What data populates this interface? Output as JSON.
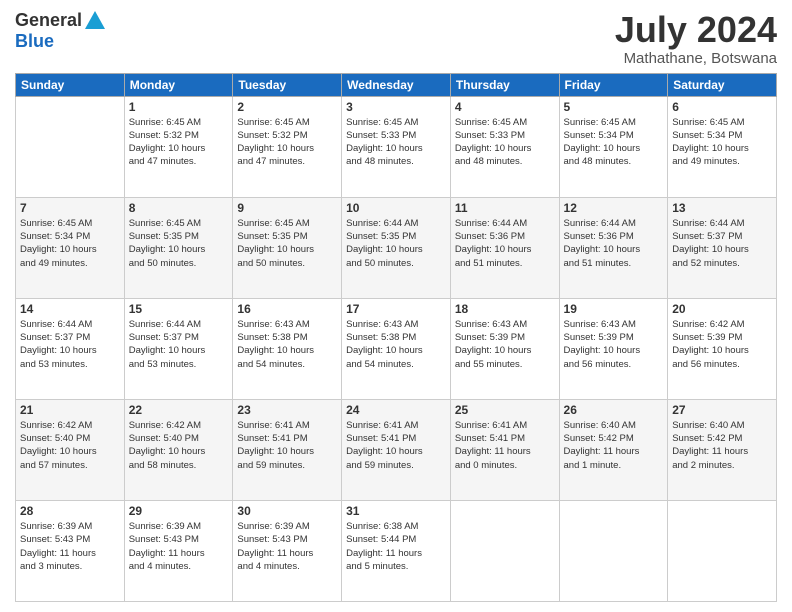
{
  "logo": {
    "general": "General",
    "blue": "Blue"
  },
  "title": {
    "month_year": "July 2024",
    "location": "Mathathane, Botswana"
  },
  "days_of_week": [
    "Sunday",
    "Monday",
    "Tuesday",
    "Wednesday",
    "Thursday",
    "Friday",
    "Saturday"
  ],
  "weeks": [
    [
      {
        "day": "",
        "info": ""
      },
      {
        "day": "1",
        "info": "Sunrise: 6:45 AM\nSunset: 5:32 PM\nDaylight: 10 hours\nand 47 minutes."
      },
      {
        "day": "2",
        "info": "Sunrise: 6:45 AM\nSunset: 5:32 PM\nDaylight: 10 hours\nand 47 minutes."
      },
      {
        "day": "3",
        "info": "Sunrise: 6:45 AM\nSunset: 5:33 PM\nDaylight: 10 hours\nand 48 minutes."
      },
      {
        "day": "4",
        "info": "Sunrise: 6:45 AM\nSunset: 5:33 PM\nDaylight: 10 hours\nand 48 minutes."
      },
      {
        "day": "5",
        "info": "Sunrise: 6:45 AM\nSunset: 5:34 PM\nDaylight: 10 hours\nand 48 minutes."
      },
      {
        "day": "6",
        "info": "Sunrise: 6:45 AM\nSunset: 5:34 PM\nDaylight: 10 hours\nand 49 minutes."
      }
    ],
    [
      {
        "day": "7",
        "info": "Sunrise: 6:45 AM\nSunset: 5:34 PM\nDaylight: 10 hours\nand 49 minutes."
      },
      {
        "day": "8",
        "info": "Sunrise: 6:45 AM\nSunset: 5:35 PM\nDaylight: 10 hours\nand 50 minutes."
      },
      {
        "day": "9",
        "info": "Sunrise: 6:45 AM\nSunset: 5:35 PM\nDaylight: 10 hours\nand 50 minutes."
      },
      {
        "day": "10",
        "info": "Sunrise: 6:44 AM\nSunset: 5:35 PM\nDaylight: 10 hours\nand 50 minutes."
      },
      {
        "day": "11",
        "info": "Sunrise: 6:44 AM\nSunset: 5:36 PM\nDaylight: 10 hours\nand 51 minutes."
      },
      {
        "day": "12",
        "info": "Sunrise: 6:44 AM\nSunset: 5:36 PM\nDaylight: 10 hours\nand 51 minutes."
      },
      {
        "day": "13",
        "info": "Sunrise: 6:44 AM\nSunset: 5:37 PM\nDaylight: 10 hours\nand 52 minutes."
      }
    ],
    [
      {
        "day": "14",
        "info": "Sunrise: 6:44 AM\nSunset: 5:37 PM\nDaylight: 10 hours\nand 53 minutes."
      },
      {
        "day": "15",
        "info": "Sunrise: 6:44 AM\nSunset: 5:37 PM\nDaylight: 10 hours\nand 53 minutes."
      },
      {
        "day": "16",
        "info": "Sunrise: 6:43 AM\nSunset: 5:38 PM\nDaylight: 10 hours\nand 54 minutes."
      },
      {
        "day": "17",
        "info": "Sunrise: 6:43 AM\nSunset: 5:38 PM\nDaylight: 10 hours\nand 54 minutes."
      },
      {
        "day": "18",
        "info": "Sunrise: 6:43 AM\nSunset: 5:39 PM\nDaylight: 10 hours\nand 55 minutes."
      },
      {
        "day": "19",
        "info": "Sunrise: 6:43 AM\nSunset: 5:39 PM\nDaylight: 10 hours\nand 56 minutes."
      },
      {
        "day": "20",
        "info": "Sunrise: 6:42 AM\nSunset: 5:39 PM\nDaylight: 10 hours\nand 56 minutes."
      }
    ],
    [
      {
        "day": "21",
        "info": "Sunrise: 6:42 AM\nSunset: 5:40 PM\nDaylight: 10 hours\nand 57 minutes."
      },
      {
        "day": "22",
        "info": "Sunrise: 6:42 AM\nSunset: 5:40 PM\nDaylight: 10 hours\nand 58 minutes."
      },
      {
        "day": "23",
        "info": "Sunrise: 6:41 AM\nSunset: 5:41 PM\nDaylight: 10 hours\nand 59 minutes."
      },
      {
        "day": "24",
        "info": "Sunrise: 6:41 AM\nSunset: 5:41 PM\nDaylight: 10 hours\nand 59 minutes."
      },
      {
        "day": "25",
        "info": "Sunrise: 6:41 AM\nSunset: 5:41 PM\nDaylight: 11 hours\nand 0 minutes."
      },
      {
        "day": "26",
        "info": "Sunrise: 6:40 AM\nSunset: 5:42 PM\nDaylight: 11 hours\nand 1 minute."
      },
      {
        "day": "27",
        "info": "Sunrise: 6:40 AM\nSunset: 5:42 PM\nDaylight: 11 hours\nand 2 minutes."
      }
    ],
    [
      {
        "day": "28",
        "info": "Sunrise: 6:39 AM\nSunset: 5:43 PM\nDaylight: 11 hours\nand 3 minutes."
      },
      {
        "day": "29",
        "info": "Sunrise: 6:39 AM\nSunset: 5:43 PM\nDaylight: 11 hours\nand 4 minutes."
      },
      {
        "day": "30",
        "info": "Sunrise: 6:39 AM\nSunset: 5:43 PM\nDaylight: 11 hours\nand 4 minutes."
      },
      {
        "day": "31",
        "info": "Sunrise: 6:38 AM\nSunset: 5:44 PM\nDaylight: 11 hours\nand 5 minutes."
      },
      {
        "day": "",
        "info": ""
      },
      {
        "day": "",
        "info": ""
      },
      {
        "day": "",
        "info": ""
      }
    ]
  ]
}
